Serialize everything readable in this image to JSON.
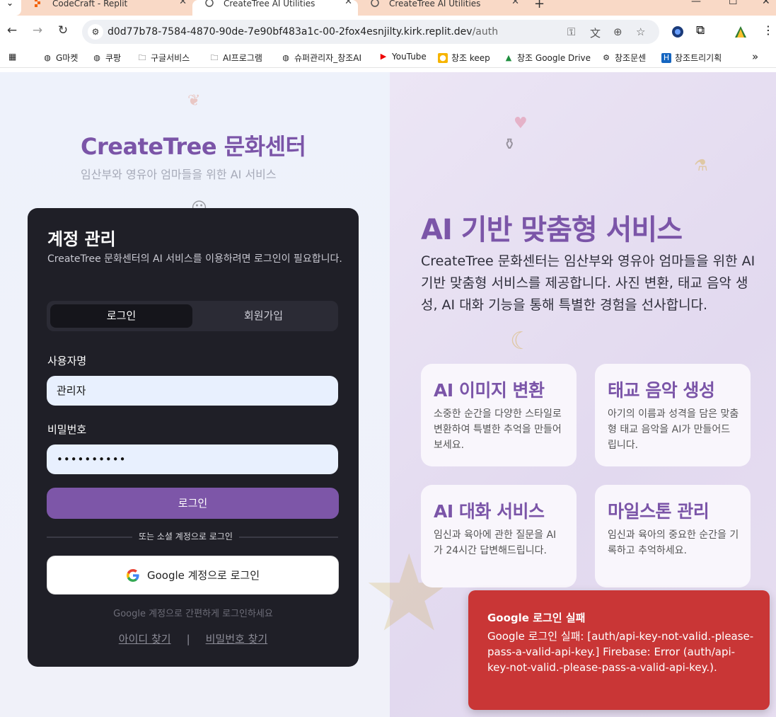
{
  "browser": {
    "tabs": [
      {
        "title": "CodeCraft - Replit"
      },
      {
        "title": "CreateTree AI Utilities"
      },
      {
        "title": "CreateTree AI Utilities"
      }
    ],
    "url": {
      "host": "d0d77b78-7584-4870-90de-7e90bf483a1c-00-2fox4esnjilty.kirk.replit.dev",
      "path": "/auth"
    },
    "bookmarks": [
      "G마켓",
      "쿠팡",
      "구글서비스",
      "AI프로그램",
      "슈퍼관리자_창조AI",
      "YouTube",
      "창조 keep",
      "창조 Google Drive",
      "창조문센",
      "창조트리기획"
    ]
  },
  "brand": {
    "title": "CreateTree 문화센터",
    "subtitle": "임산부와 영유아 엄마들을 위한 AI 서비스"
  },
  "login_card": {
    "title": "계정 관리",
    "description": "CreateTree 문화센터의 AI 서비스를 이용하려면 로그인이 필요합니다.",
    "tabs": {
      "login": "로그인",
      "signup": "회원가입"
    },
    "username_label": "사용자명",
    "username_value": "관리자",
    "password_label": "비밀번호",
    "password_value": "••••••••••",
    "login_button": "로그인",
    "divider_text": "또는 소셜 계정으로 로그인",
    "google_button": "Google 계정으로 로그인",
    "google_hint": "Google 계정으로 간편하게 로그인하세요",
    "find_id": "아이디 찾기",
    "separator": "|",
    "find_password": "비밀번호 찾기"
  },
  "hero": {
    "title": "AI 기반 맞춤형 서비스",
    "description": "CreateTree 문화센터는 임산부와 영유아 엄마들을 위한 AI 기반 맞춤형 서비스를 제공합니다. 사진 변환, 태교 음악 생성, AI 대화 기능을 통해 특별한 경험을 선사합니다."
  },
  "features": [
    {
      "title": "AI 이미지 변환",
      "text": "소중한 순간을 다양한 스타일로 변환하여 특별한 추억을 만들어보세요."
    },
    {
      "title": "태교 음악 생성",
      "text": "아기의 이름과 성격을 담은 맞춤형 태교 음악을 AI가 만들어드립니다."
    },
    {
      "title": "AI 대화 서비스",
      "text": "임신과 육아에 관한 질문을 AI가 24시간 답변해드립니다."
    },
    {
      "title": "마일스톤 관리",
      "text": "임신과 육아의 중요한 순간을 기록하고 추억하세요."
    }
  ],
  "toast": {
    "title": "Google 로그인 실패",
    "body": "Google 로그인 실패: [auth/api-key-not-valid.-please-pass-a-valid-api-key.] Firebase: Error (auth/api-key-not-valid.-please-pass-a-valid-api-key.)."
  },
  "colors": {
    "brand": "#7b55a8",
    "card": "#1f1f27",
    "toast": "#c93636"
  }
}
